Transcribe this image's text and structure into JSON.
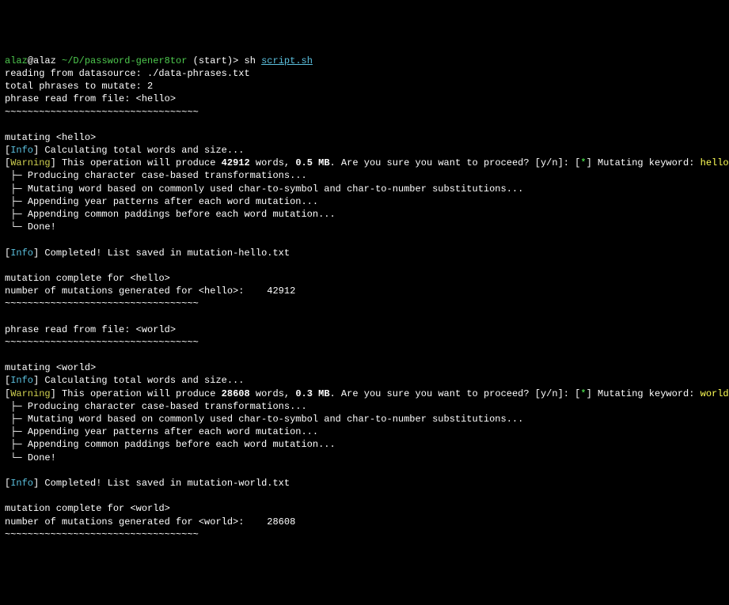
{
  "prompt": {
    "user": "alaz",
    "host": "alaz",
    "path": "~/D/password-gener8tor",
    "branch": "start",
    "arrow": ">",
    "cmd_sh": "sh",
    "cmd_script": "script.sh"
  },
  "headers": {
    "reading": "reading from datasource: ./data-phrases.txt",
    "total": "total phrases to mutate: 2",
    "sep": "~~~~~~~~~~~~~~~~~~~~~~~~~~~~~~~~~~"
  },
  "phrase_label": "phrase read from file:",
  "mutating_label": "mutating",
  "info_label": "Info",
  "warning_label": "Warning",
  "calc_text": "Calculating total words and size...",
  "warn_prefix": "This operation will produce",
  "words_label": "words,",
  "proceed_label": ". Are you sure you want to proceed? [y/n]:",
  "mutating_kw": "Mutating keyword:",
  "star": "*",
  "steps": {
    "s1": "Producing character case-based transformations...",
    "s2": "Mutating word based on commonly used char-to-symbol and char-to-number substitutions...",
    "s3": "Appending year patterns after each word mutation...",
    "s4": "Appending common paddings before each word mutation...",
    "s5": "Done!"
  },
  "completed_prefix": "Completed! List saved in",
  "complete_label": "mutation complete for",
  "num_gen_label": "number of mutations generated for",
  "tree_branch": " ├─ ",
  "tree_last": " └─ ",
  "block1": {
    "phrase": "<hello>",
    "keyword": "hello",
    "words": "42912",
    "size": "0.5 MB",
    "savefile": "mutation-hello.txt",
    "count": "42912"
  },
  "block2": {
    "phrase": "<world>",
    "keyword": "world",
    "words": "28608",
    "size": "0.3 MB",
    "savefile": "mutation-world.txt",
    "count": "28608"
  }
}
